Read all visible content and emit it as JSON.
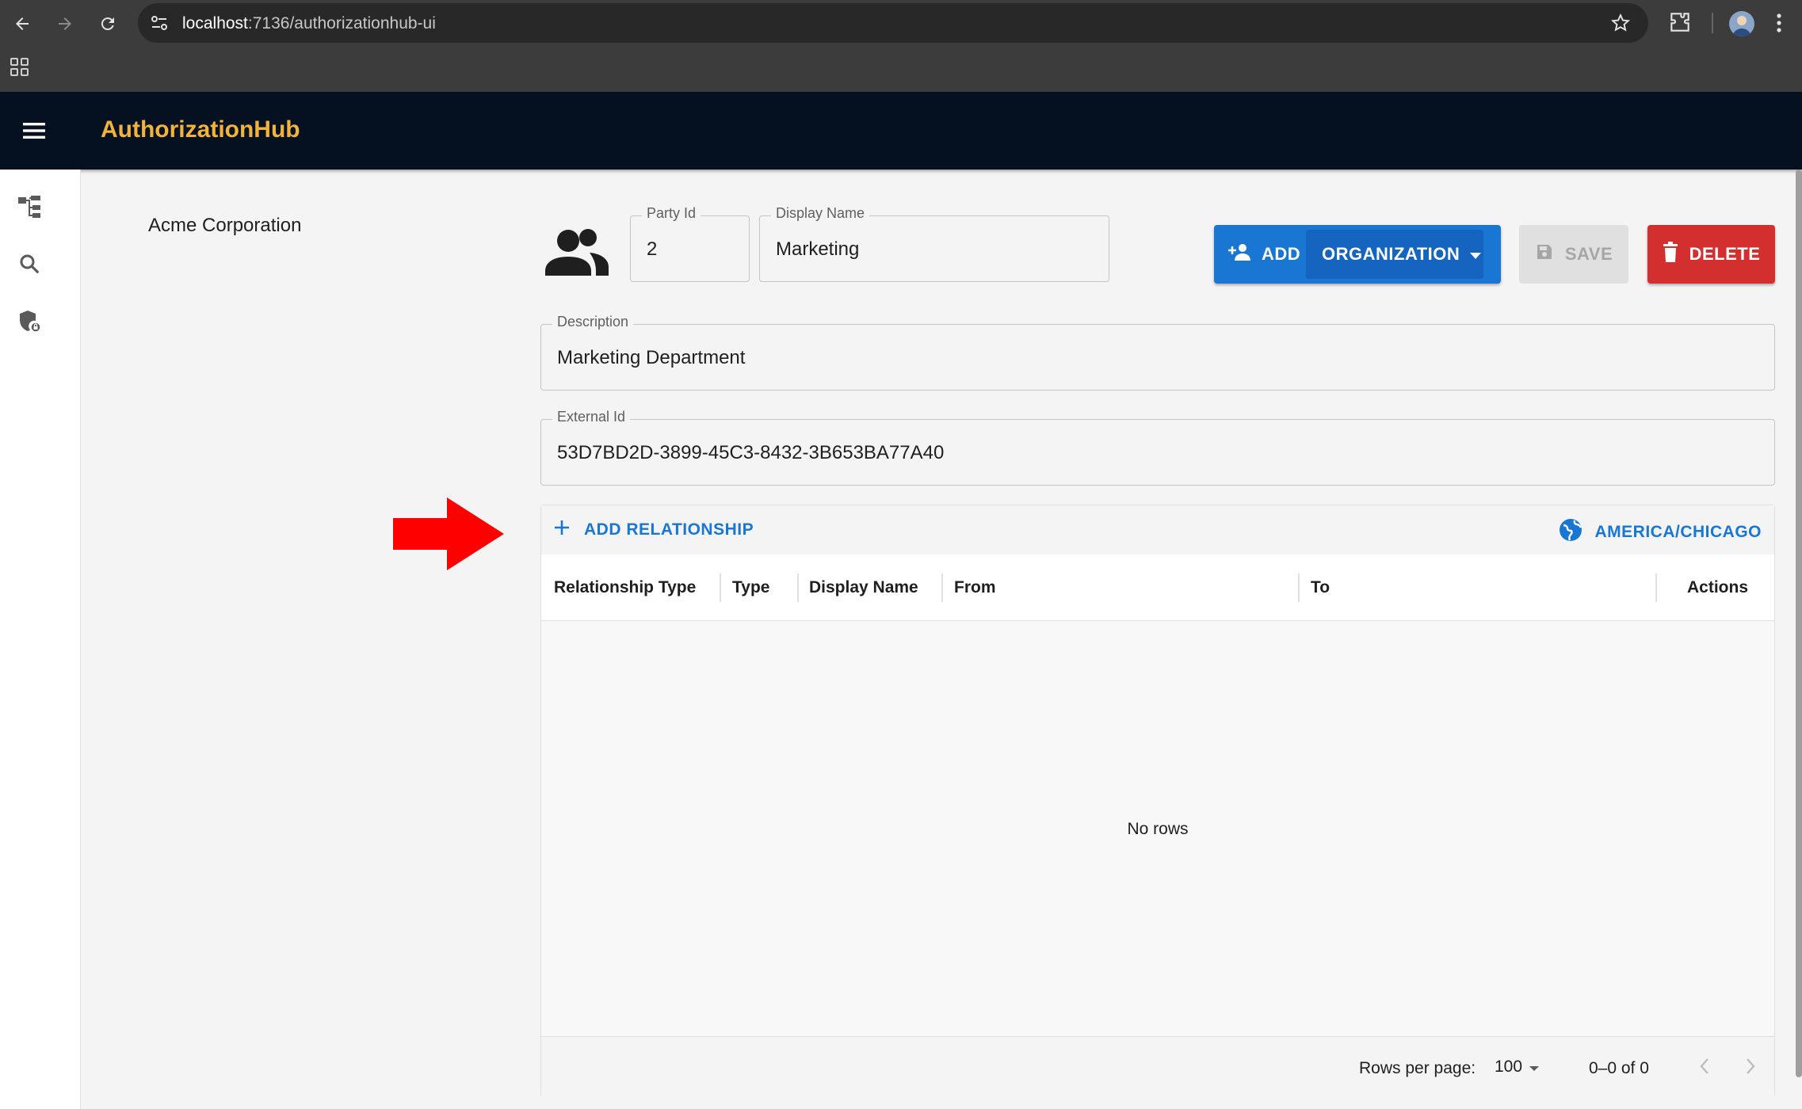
{
  "browser": {
    "url_host": "localhost",
    "url_path": ":7136/authorizationhub-ui"
  },
  "app": {
    "title": "AuthorizationHub"
  },
  "tree": {
    "selected_org": "Acme Corporation"
  },
  "form": {
    "party_id": {
      "label": "Party Id",
      "value": "2"
    },
    "display_name": {
      "label": "Display Name",
      "value": "Marketing"
    },
    "description": {
      "label": "Description",
      "value": "Marketing Department"
    },
    "external_id": {
      "label": "External Id",
      "value": "53D7BD2D-3899-45C3-8432-3B653BA77A40"
    }
  },
  "actions": {
    "add_label": "ADD",
    "add_type_label": "ORGANIZATION",
    "save_label": "SAVE",
    "delete_label": "DELETE"
  },
  "relationships": {
    "add_label": "ADD RELATIONSHIP",
    "timezone": "AMERICA/CHICAGO",
    "columns": [
      "Relationship Type",
      "Type",
      "Display Name",
      "From",
      "To",
      "Actions"
    ],
    "empty_text": "No rows",
    "rows_per_page_label": "Rows per page:",
    "rows_per_page_value": "100",
    "range_text": "0–0 of 0"
  },
  "colors": {
    "appbar_bg": "#051121",
    "title_accent": "#f2b33d",
    "primary": "#1976d2",
    "danger": "#d32f2f",
    "annotation_arrow": "#ff0000"
  }
}
